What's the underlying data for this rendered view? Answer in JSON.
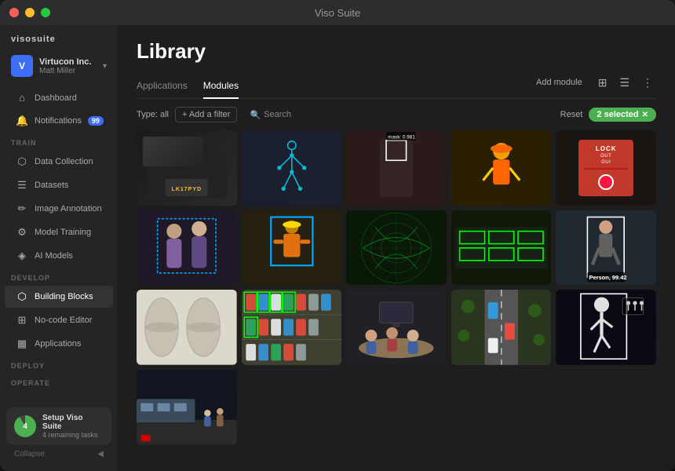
{
  "window": {
    "title": "Viso Suite"
  },
  "sidebar": {
    "logo": "visosuite",
    "account": {
      "initial": "V",
      "company": "Virtucon Inc.",
      "user": "Matt Miller"
    },
    "nav_items": [
      {
        "id": "dashboard",
        "icon": "⌂",
        "label": "Dashboard",
        "badge": null
      },
      {
        "id": "notifications",
        "icon": "🔔",
        "label": "Notifications",
        "badge": "99"
      }
    ],
    "train_section": "TRAIN",
    "train_items": [
      {
        "id": "data-collection",
        "icon": "⬡",
        "label": "Data Collection"
      },
      {
        "id": "datasets",
        "icon": "☰",
        "label": "Datasets"
      },
      {
        "id": "image-annotation",
        "icon": "✏",
        "label": "Image Annotation"
      },
      {
        "id": "model-training",
        "icon": "⚙",
        "label": "Model Training"
      },
      {
        "id": "ai-models",
        "icon": "🧠",
        "label": "AI Models"
      }
    ],
    "develop_section": "DEVELOP",
    "develop_items": [
      {
        "id": "building-blocks",
        "icon": "⬡",
        "label": "Building Blocks",
        "active": true
      },
      {
        "id": "no-code-editor",
        "icon": "⊞",
        "label": "No-code Editor"
      },
      {
        "id": "applications",
        "icon": "▦",
        "label": "Applications"
      }
    ],
    "deploy_section": "DEPLOY",
    "operate_section": "OPERATE",
    "setup": {
      "number": "4",
      "title": "Setup Viso Suite",
      "subtitle": "4 remaining tasks"
    },
    "collapse_label": "Collapse"
  },
  "main": {
    "page_title": "Library",
    "tabs": [
      {
        "id": "applications",
        "label": "Applications",
        "active": false
      },
      {
        "id": "modules",
        "label": "Modules",
        "active": true
      }
    ],
    "toolbar": {
      "add_module": "Add module",
      "type_filter": "Type: all",
      "add_filter": "+ Add a filter",
      "search_placeholder": "Search",
      "reset": "Reset",
      "selected": "2 selected"
    },
    "grid_items": [
      {
        "id": 1,
        "type": "car",
        "label": "",
        "selected": false
      },
      {
        "id": 2,
        "type": "skeleton",
        "label": "",
        "selected": false
      },
      {
        "id": 3,
        "type": "face",
        "label": "mask: 0.981",
        "selected": false
      },
      {
        "id": 4,
        "type": "worker",
        "label": "",
        "selected": false
      },
      {
        "id": 5,
        "type": "alarm",
        "label": "",
        "selected": false
      },
      {
        "id": 6,
        "type": "group",
        "label": "",
        "selected": false
      },
      {
        "id": 7,
        "type": "construct",
        "label": "",
        "selected": false
      },
      {
        "id": 8,
        "type": "fisheye",
        "label": "",
        "selected": false
      },
      {
        "id": 9,
        "type": "greenlines",
        "label": "",
        "selected": false
      },
      {
        "id": 10,
        "type": "person-detect",
        "label": "Person, 99.42",
        "selected": false
      },
      {
        "id": 11,
        "type": "partial1",
        "label": "",
        "selected": false
      },
      {
        "id": 12,
        "type": "parking",
        "label": "",
        "selected": false
      },
      {
        "id": 13,
        "type": "meeting",
        "label": "",
        "selected": false
      },
      {
        "id": 14,
        "type": "road",
        "label": "",
        "selected": false
      },
      {
        "id": 15,
        "type": "walk",
        "label": "",
        "selected": false
      },
      {
        "id": 16,
        "type": "train",
        "label": "",
        "selected": false
      },
      {
        "id": 17,
        "type": "partial2",
        "label": "",
        "selected": false
      }
    ]
  }
}
